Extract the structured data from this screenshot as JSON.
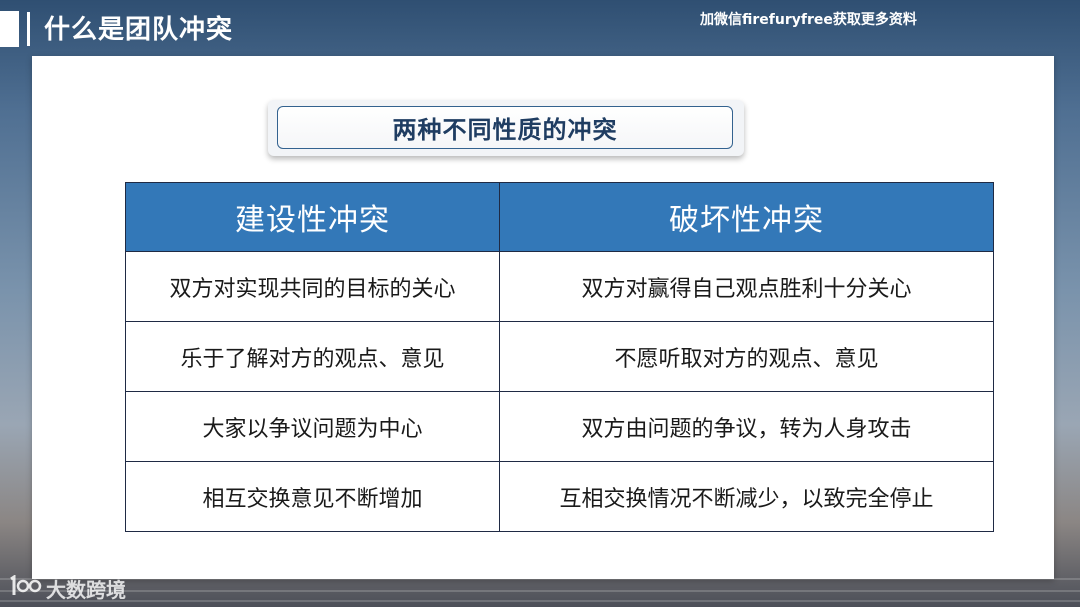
{
  "header": {
    "title": "什么是团队冲突",
    "promo": "加微信firefuryfree获取更多资料"
  },
  "subtitle": "两种不同性质的冲突",
  "table": {
    "headers": [
      "建设性冲突",
      "破坏性冲突"
    ],
    "rows": [
      [
        "双方对实现共同的目标的关心",
        "双方对赢得自己观点胜利十分关心"
      ],
      [
        "乐于了解对方的观点、意见",
        "不愿听取对方的观点、意见"
      ],
      [
        "大家以争议问题为中心",
        "双方由问题的争议，转为人身攻击"
      ],
      [
        "相互交换意见不断增加",
        "互相交换情况不断减少，以致完全停止"
      ]
    ]
  },
  "watermark": {
    "icon": "100-logo-icon",
    "text": "大数跨境"
  },
  "colors": {
    "header_blue": "#3378b8",
    "subtitle_text": "#1f3d62",
    "subtitle_border": "#33628f"
  }
}
